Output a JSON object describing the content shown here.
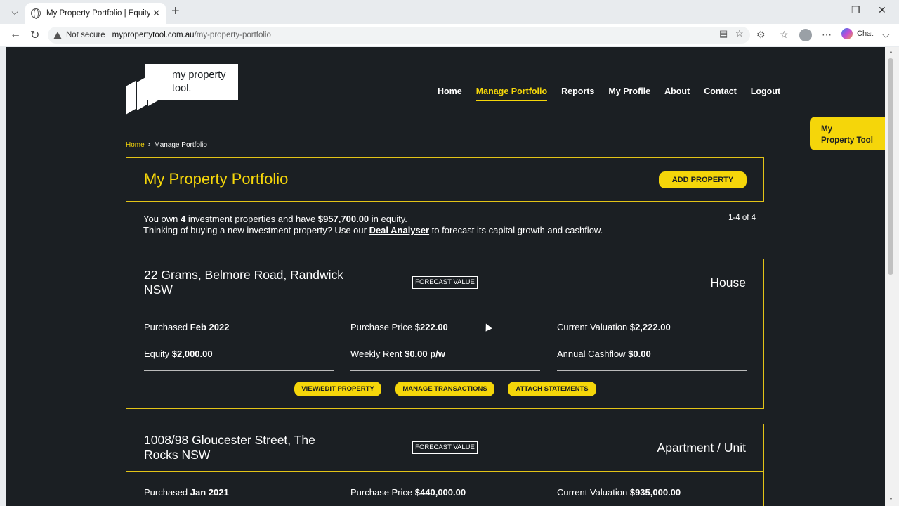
{
  "browser": {
    "tab_title": "My Property Portfolio | Equity Rise",
    "not_secure": "Not secure",
    "url_host": "mypropertytool.com.au",
    "url_path": "/my-property-portfolio",
    "chat_label": "Chat"
  },
  "site": {
    "logo_text_line1": "my property",
    "logo_text_line2": "tool.",
    "nav": [
      "Home",
      "Manage Portfolio",
      "Reports",
      "My Profile",
      "About",
      "Contact",
      "Logout"
    ],
    "side_tab_line1": "My",
    "side_tab_line2": "Property Tool"
  },
  "breadcrumb": {
    "home": "Home",
    "current": "Manage Portfolio"
  },
  "header": {
    "title": "My Property Portfolio",
    "add_button": "ADD PROPERTY"
  },
  "intro": {
    "p1_a": "You own ",
    "count": "4",
    "p1_b": " investment properties and have ",
    "equity": "$957,700.00",
    "p1_c": " in equity.",
    "p2_a": "Thinking of buying a new investment property? Use our ",
    "link": "Deal Analyser",
    "p2_b": " to forecast its capital growth and cashflow.",
    "pagination": "1-4 of 4"
  },
  "properties": [
    {
      "address": "22 Grams, Belmore Road, Randwick NSW",
      "forecast_label": "FORECAST VALUE",
      "type": "House",
      "purchased_label": "Purchased",
      "purchased": "Feb 2022",
      "price_label": "Purchase Price",
      "price": "$222.00",
      "valuation_label": "Current Valuation",
      "valuation": "$2,222.00",
      "equity_label": "Equity",
      "equity": "$2,000.00",
      "rent_label": "Weekly Rent",
      "rent": "$0.00 p/w",
      "cashflow_label": "Annual Cashflow",
      "cashflow": "$0.00",
      "buttons": [
        "VIEW/EDIT PROPERTY",
        "MANAGE TRANSACTIONS",
        "ATTACH STATEMENTS"
      ]
    },
    {
      "address": "1008/98 Gloucester Street, The Rocks NSW",
      "forecast_label": "FORECAST VALUE",
      "type": "Apartment / Unit",
      "purchased_label": "Purchased",
      "purchased": "Jan 2021",
      "price_label": "Purchase Price",
      "price": "$440,000.00",
      "valuation_label": "Current Valuation",
      "valuation": "$935,000.00"
    }
  ]
}
